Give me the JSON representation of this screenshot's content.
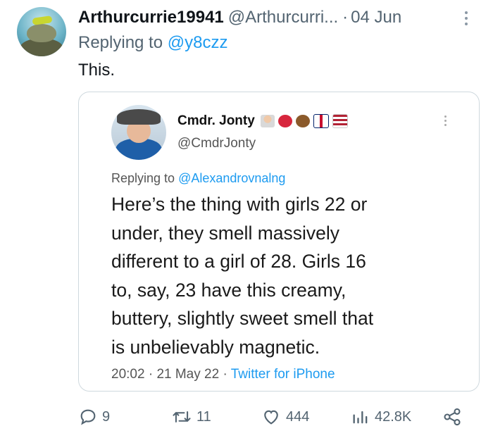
{
  "tweet": {
    "author_name": "Arthurcurrie19941",
    "author_handle": "@Arthurcurri...",
    "separator": "·",
    "date": "04 Jun",
    "reply_prefix": "Replying to",
    "reply_to": "@y8czz",
    "text": "This."
  },
  "quoted": {
    "author_name": "Cmdr. Jonty",
    "author_handle": "@CmdrJonty",
    "reply_prefix": "Replying to",
    "reply_to": "@Alexandrovnalng",
    "text_lines": [
      "Here’s the thing with girls 22 or",
      "under, they smell massively",
      "different to a girl of 28. Girls 16",
      "to, say, 23 have this creamy,",
      "buttery,  slightly sweet smell that",
      "is unbelievably magnetic."
    ],
    "time": "20:02",
    "sep1": "·",
    "date": "21 May 22",
    "sep2": "·",
    "source": "Twitter for iPhone"
  },
  "actions": {
    "replies": "9",
    "retweets": "11",
    "likes": "444",
    "views": "42.8K"
  },
  "colors": {
    "accent": "#1d9bf0",
    "secondary_text": "#536471",
    "border": "#cfd9de"
  },
  "icons": [
    "reply-icon",
    "retweet-icon",
    "like-icon",
    "views-icon",
    "share-icon",
    "more-icon"
  ]
}
